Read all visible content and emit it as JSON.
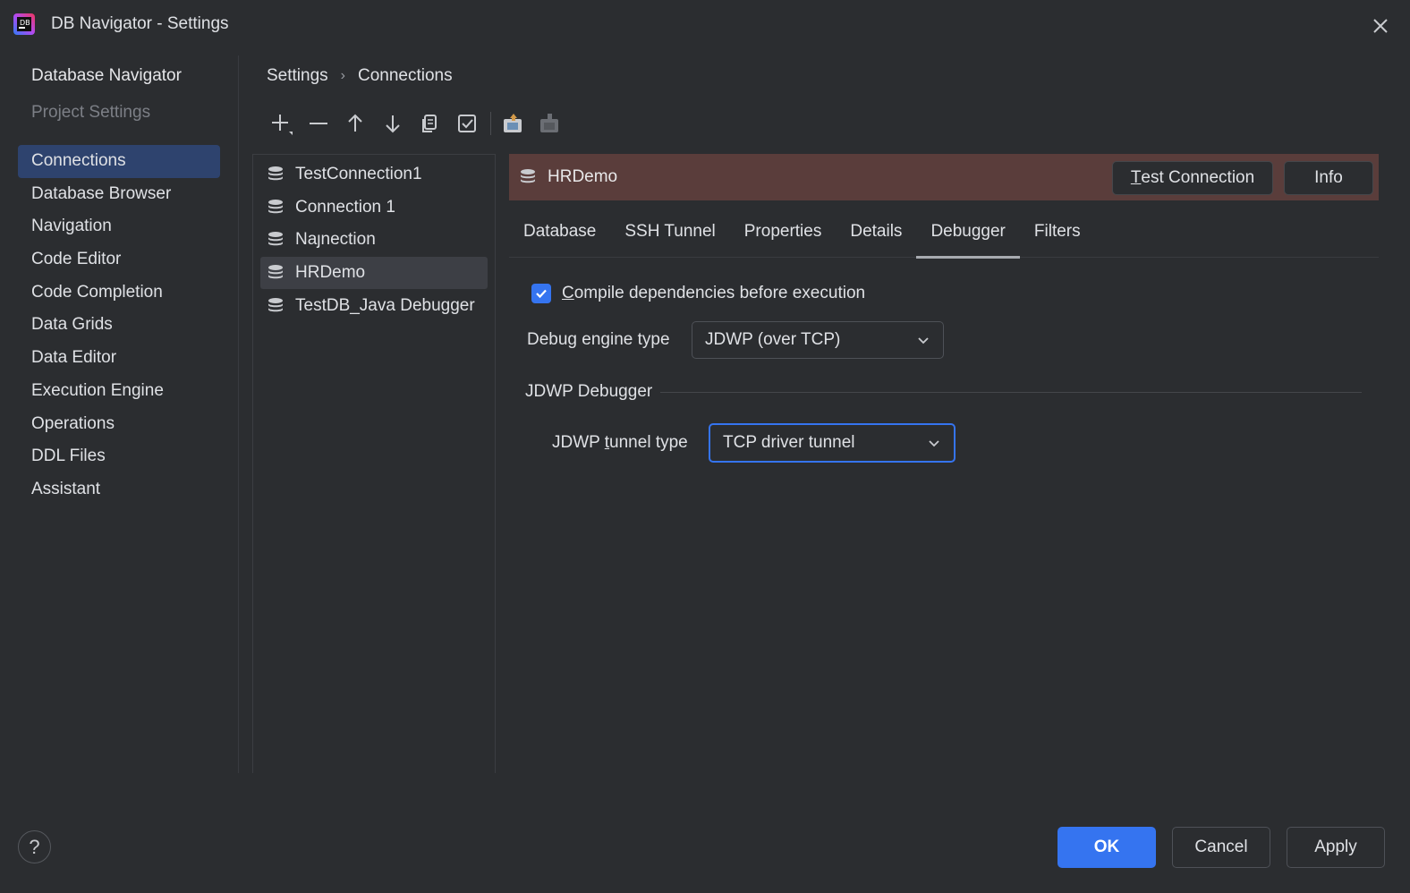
{
  "window": {
    "title": "DB Navigator - Settings"
  },
  "sidebar": {
    "header_active": "Database Navigator",
    "header_muted": "Project Settings",
    "items": [
      {
        "label": "Connections",
        "selected": true
      },
      {
        "label": "Database Browser"
      },
      {
        "label": "Navigation"
      },
      {
        "label": "Code Editor"
      },
      {
        "label": "Code Completion"
      },
      {
        "label": "Data Grids"
      },
      {
        "label": "Data Editor"
      },
      {
        "label": "Execution Engine"
      },
      {
        "label": "Operations"
      },
      {
        "label": "DDL Files"
      },
      {
        "label": "Assistant"
      }
    ]
  },
  "breadcrumb": {
    "root": "Settings",
    "separator": "›",
    "current": "Connections"
  },
  "toolbar": {
    "icons": [
      "add-icon",
      "remove-icon",
      "move-up-icon",
      "move-down-icon",
      "copy-icon",
      "check-icon",
      "export-icon",
      "import-icon"
    ]
  },
  "connections": [
    {
      "name": "TestConnection1"
    },
    {
      "name": "Connection 1"
    },
    {
      "name": "Naȷnection"
    },
    {
      "name": "HRDemo",
      "selected": true
    },
    {
      "name": "TestDB_Java Debugger"
    }
  ],
  "detail": {
    "title": "HRDemo",
    "header_color": "#5a3d3b",
    "test_connection_first": "T",
    "test_connection_rest": "est Connection",
    "info_label": "Info",
    "tabs": [
      "Database",
      "SSH Tunnel",
      "Properties",
      "Details",
      "Debugger",
      "Filters"
    ],
    "active_tab": "Debugger",
    "compile_checkbox": {
      "mnemonic": "C",
      "rest": "ompile dependencies before execution",
      "checked": true
    },
    "debug_engine": {
      "label": "Debug engine type",
      "value": "JDWP (over TCP)"
    },
    "group_title": "JDWP Debugger",
    "tunnel": {
      "label_pre": "JDWP ",
      "label_mnemonic": "t",
      "label_post": "unnel type",
      "value": "TCP driver tunnel"
    }
  },
  "footer": {
    "help": "?",
    "ok": "OK",
    "cancel": "Cancel",
    "apply": "Apply"
  },
  "colors": {
    "accent": "#3574f0",
    "background": "#2b2d30",
    "selection": "#2e436e"
  }
}
